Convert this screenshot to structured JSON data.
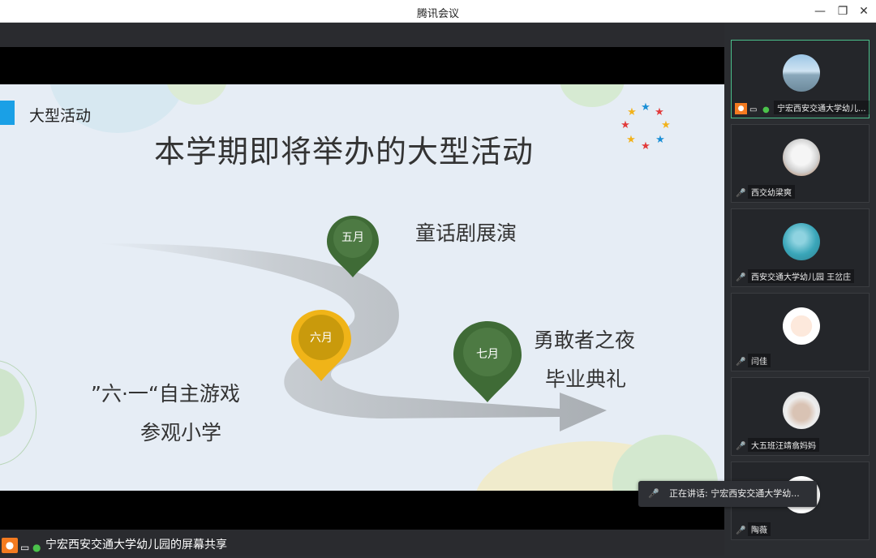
{
  "window": {
    "title": "腾讯会议",
    "minimize": "—",
    "restore": "❐",
    "close": "✕"
  },
  "slide": {
    "section_tag": "大型活动",
    "heading": "本学期即将举办的大型活动",
    "pins": [
      {
        "label": "五月",
        "color": "#3f6b36"
      },
      {
        "label": "六月",
        "color": "#e8a50e"
      },
      {
        "label": "七月",
        "color": "#3f6b36"
      }
    ],
    "may_event": "童话剧展演",
    "june_event_line1": "”六·一“自主游戏",
    "june_event_line2": "参观小学",
    "july_event_line1": "勇敢者之夜",
    "july_event_line2": "毕业典礼"
  },
  "participants": [
    {
      "name": "宁宏西安交通大学幼儿...",
      "active": true
    },
    {
      "name": "西交幼梁爽"
    },
    {
      "name": "西安交通大学幼儿园 王岔庄"
    },
    {
      "name": "闫佳"
    },
    {
      "name": "大五班汪靖翕妈妈"
    },
    {
      "name": "陶薇"
    }
  ],
  "speaking": "正在讲话: 宁宏西安交通大学幼...",
  "share_label": "宁宏西安交通大学幼儿园的屏幕共享"
}
